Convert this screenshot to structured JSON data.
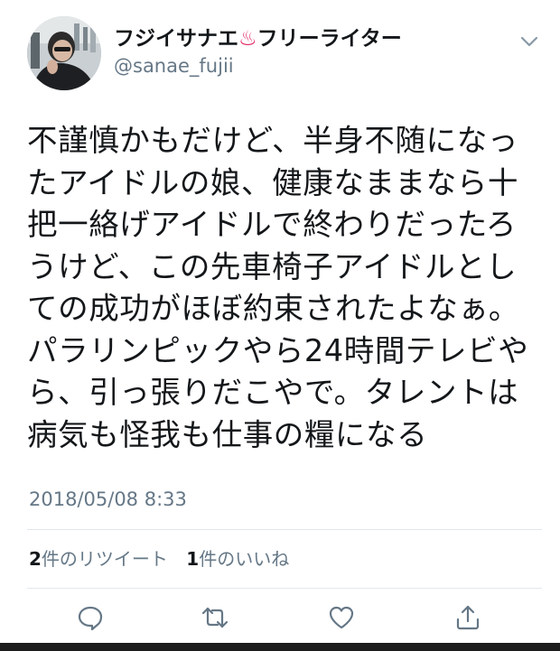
{
  "user": {
    "display_name": "フジイサナエ",
    "name_emoji": "♨",
    "display_name_suffix": "フリーライター",
    "handle": "@sanae_fujii"
  },
  "tweet": {
    "text": "不謹慎かもだけど、半身不随になっ\nたアイドルの娘、健康なままなら十\n把一絡げアイドルで終わりだったろ\nうけど、この先車椅子アイドルとし\nての成功がほぼ約束されたよなぁ。\nパラリンピックやら24時間テレビや\nら、引っ張りだこやで。タレントは\n病気も怪我も仕事の糧になる",
    "timestamp": "2018/05/08 8:33"
  },
  "stats": {
    "retweets_count": "2",
    "retweets_label": "件のリツイート",
    "likes_count": "1",
    "likes_label": "件のいいね"
  },
  "actions": {
    "reply_icon": "reply-icon",
    "retweet_icon": "retweet-icon",
    "like_icon": "heart-icon",
    "share_icon": "share-icon"
  },
  "colors": {
    "text": "#14171a",
    "secondary_text": "#657786",
    "divider": "#e1e8ed",
    "emoji": "#e0245e"
  }
}
